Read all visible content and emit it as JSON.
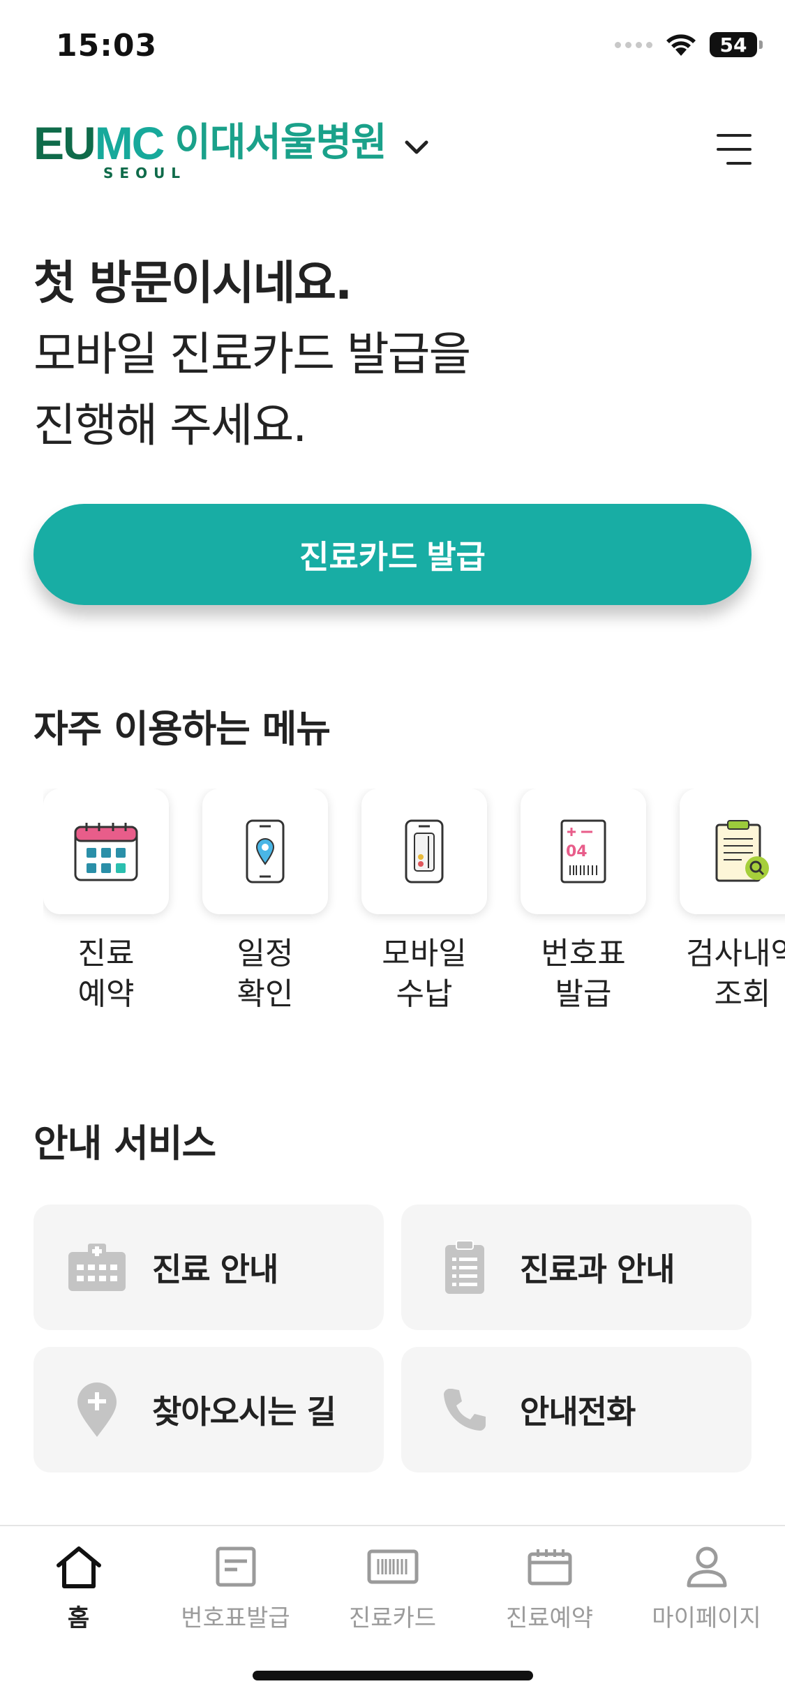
{
  "status_bar": {
    "time": "15:03",
    "battery": "54"
  },
  "header": {
    "logo_text": "EUMC",
    "logo_sub": "SEOUL",
    "hospital_name": "이대서울병원"
  },
  "hero": {
    "line1": "첫 방문이시네요.",
    "line2": "모바일 진료카드 발급을",
    "line3": "진행해 주세요."
  },
  "cta": {
    "label": "진료카드 발급"
  },
  "quick_menu": {
    "title": "자주 이용하는 메뉴",
    "items": [
      {
        "line1": "진료",
        "line2": "예약",
        "icon": "calendar-icon"
      },
      {
        "line1": "일정",
        "line2": "확인",
        "icon": "phone-location-icon"
      },
      {
        "line1": "모바일",
        "line2": "수납",
        "icon": "mobile-card-icon"
      },
      {
        "line1": "번호표",
        "line2": "발급",
        "icon": "ticket-icon"
      },
      {
        "line1": "검사내역",
        "line2": "조회",
        "icon": "clipboard-search-icon"
      }
    ]
  },
  "services": {
    "title": "안내 서비스",
    "items": [
      {
        "label": "진료 안내",
        "icon": "hospital-icon"
      },
      {
        "label": "진료과 안내",
        "icon": "clipboard-list-icon"
      },
      {
        "label": "찾아오시는 길",
        "icon": "map-pin-icon"
      },
      {
        "label": "안내전화",
        "icon": "phone-icon"
      }
    ]
  },
  "tabbar": {
    "items": [
      {
        "label": "홈",
        "icon": "home-icon",
        "active": true
      },
      {
        "label": "번호표발급",
        "icon": "ticket-tab-icon"
      },
      {
        "label": "진료카드",
        "icon": "barcode-card-icon"
      },
      {
        "label": "진료예약",
        "icon": "calendar-tab-icon"
      },
      {
        "label": "마이페이지",
        "icon": "user-icon"
      }
    ]
  },
  "colors": {
    "primary": "#18ada4",
    "logo_green": "#0f6b4a",
    "logo_teal": "#1aa18a",
    "card_bg": "#f5f5f5"
  }
}
